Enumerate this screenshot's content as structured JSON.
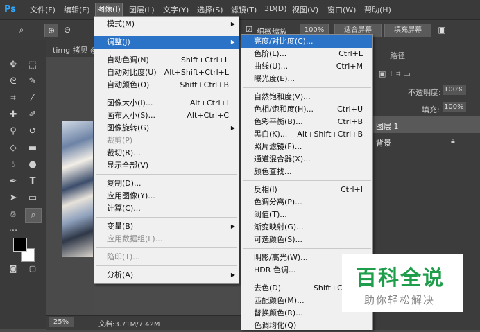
{
  "menubar": {
    "logo": "Ps",
    "items": [
      "文件(F)",
      "编辑(E)",
      "图像(I)",
      "图层(L)",
      "文字(Y)",
      "选择(S)",
      "滤镜(T)",
      "3D(D)",
      "视图(V)",
      "窗口(W)",
      "帮助(H)"
    ]
  },
  "options": {
    "checkbox_label": "细微缩放",
    "zoom_100": "100%",
    "fit_screen": "适合屏幕",
    "fill_screen": "填充屏幕"
  },
  "document": {
    "tab": "timg 拷贝 @",
    "zoom": "25%",
    "doc_info": "文档:3.71M/7.42M"
  },
  "image_menu": [
    {
      "label": "模式(M)",
      "submenu": true
    },
    {
      "sep": true
    },
    {
      "label": "调整(J)",
      "submenu": true,
      "highlight": true
    },
    {
      "sep": true
    },
    {
      "label": "自动色调(N)",
      "shortcut": "Shift+Ctrl+L"
    },
    {
      "label": "自动对比度(U)",
      "shortcut": "Alt+Shift+Ctrl+L"
    },
    {
      "label": "自动颜色(O)",
      "shortcut": "Shift+Ctrl+B"
    },
    {
      "sep": true
    },
    {
      "label": "图像大小(I)...",
      "shortcut": "Alt+Ctrl+I"
    },
    {
      "label": "画布大小(S)...",
      "shortcut": "Alt+Ctrl+C"
    },
    {
      "label": "图像旋转(G)",
      "submenu": true
    },
    {
      "label": "裁剪(P)",
      "disabled": true
    },
    {
      "label": "裁切(R)..."
    },
    {
      "label": "显示全部(V)"
    },
    {
      "sep": true
    },
    {
      "label": "复制(D)..."
    },
    {
      "label": "应用图像(Y)..."
    },
    {
      "label": "计算(C)..."
    },
    {
      "sep": true
    },
    {
      "label": "变量(B)",
      "submenu": true
    },
    {
      "label": "应用数据组(L)...",
      "disabled": true
    },
    {
      "sep": true
    },
    {
      "label": "陷印(T)...",
      "disabled": true
    },
    {
      "sep": true
    },
    {
      "label": "分析(A)",
      "submenu": true
    }
  ],
  "adjust_menu": [
    {
      "label": "亮度/对比度(C)...",
      "highlight": true
    },
    {
      "label": "色阶(L)...",
      "shortcut": "Ctrl+L"
    },
    {
      "label": "曲线(U)...",
      "shortcut": "Ctrl+M"
    },
    {
      "label": "曝光度(E)..."
    },
    {
      "sep": true
    },
    {
      "label": "自然饱和度(V)..."
    },
    {
      "label": "色相/饱和度(H)...",
      "shortcut": "Ctrl+U"
    },
    {
      "label": "色彩平衡(B)...",
      "shortcut": "Ctrl+B"
    },
    {
      "label": "黑白(K)...",
      "shortcut": "Alt+Shift+Ctrl+B"
    },
    {
      "label": "照片滤镜(F)..."
    },
    {
      "label": "通道混合器(X)..."
    },
    {
      "label": "颜色查找..."
    },
    {
      "sep": true
    },
    {
      "label": "反相(I)",
      "shortcut": "Ctrl+I"
    },
    {
      "label": "色调分离(P)..."
    },
    {
      "label": "阈值(T)..."
    },
    {
      "label": "渐变映射(G)..."
    },
    {
      "label": "可选颜色(S)..."
    },
    {
      "sep": true
    },
    {
      "label": "阴影/高光(W)..."
    },
    {
      "label": "HDR 色调..."
    },
    {
      "sep": true
    },
    {
      "label": "去色(D)",
      "shortcut": "Shift+Ctrl+U"
    },
    {
      "label": "匹配颜色(M)..."
    },
    {
      "label": "替换颜色(R)..."
    },
    {
      "label": "色调均化(Q)"
    }
  ],
  "panels": {
    "tab_path": "路径",
    "opacity_label": "不透明度:",
    "opacity_value": "100%",
    "fill_label": "填充:",
    "fill_value": "100%",
    "layer1": "图层 1",
    "background_layer": "背景"
  },
  "watermark": {
    "title": "百科全说",
    "subtitle": "助你轻松解决"
  },
  "colors": {
    "highlight": "#2b73c7",
    "watermark_title": "#1e9e4a",
    "ps_blue": "#31a8ff"
  }
}
